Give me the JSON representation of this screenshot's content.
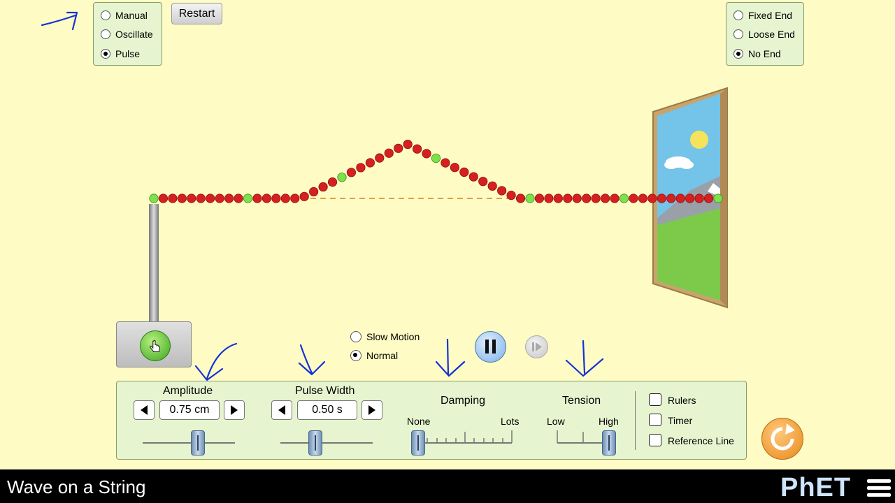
{
  "app": {
    "title": "Wave on a String",
    "brand": "PhET"
  },
  "mode_panel": {
    "options": [
      {
        "label": "Manual",
        "selected": false
      },
      {
        "label": "Oscillate",
        "selected": false
      },
      {
        "label": "Pulse",
        "selected": true
      }
    ]
  },
  "restart_label": "Restart",
  "end_panel": {
    "options": [
      {
        "label": "Fixed End",
        "selected": false
      },
      {
        "label": "Loose End",
        "selected": false
      },
      {
        "label": "No End",
        "selected": true
      }
    ]
  },
  "speed": {
    "options": [
      {
        "label": "Slow Motion",
        "selected": false
      },
      {
        "label": "Normal",
        "selected": true
      }
    ]
  },
  "controls": {
    "amplitude": {
      "label": "Amplitude",
      "value": "0.75 cm",
      "fraction": 0.6
    },
    "pulse_width": {
      "label": "Pulse Width",
      "value": "0.50 s",
      "fraction": 0.38
    },
    "damping": {
      "label": "Damping",
      "min_label": "None",
      "max_label": "Lots",
      "fraction": 0.0
    },
    "tension": {
      "label": "Tension",
      "min_label": "Low",
      "max_label": "High",
      "fraction": 1.0
    }
  },
  "checkboxes": [
    {
      "label": "Rulers",
      "checked": false
    },
    {
      "label": "Timer",
      "checked": false
    },
    {
      "label": "Reference Line",
      "checked": false
    }
  ],
  "colors": {
    "background": "#fffbc4",
    "panel": "#e6f5d0",
    "bead_red": "#d62020",
    "bead_green": "#7ee04a",
    "annotation": "#1433d6"
  }
}
